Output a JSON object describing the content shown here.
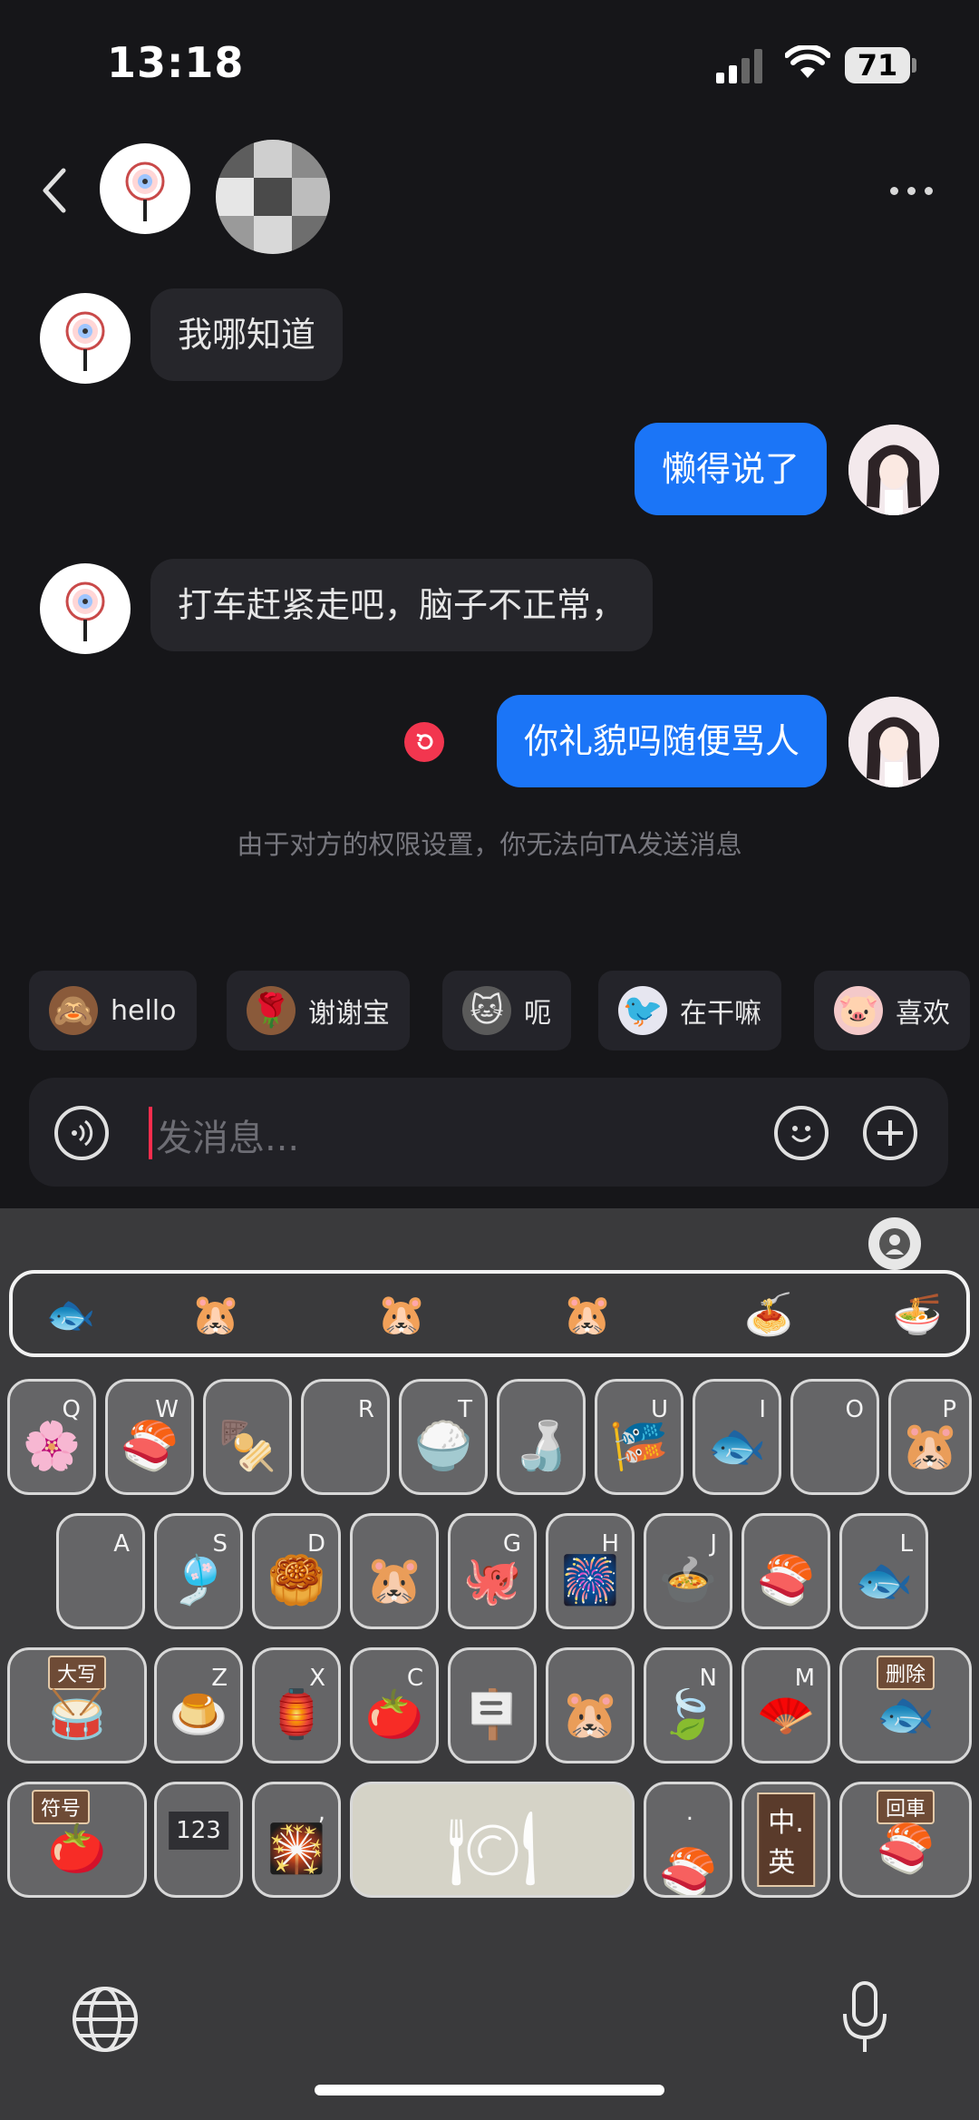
{
  "status_bar": {
    "time": "13:18",
    "battery": "71"
  },
  "header": {
    "back_icon": "chevron-left-icon",
    "more_icon": "ellipsis-icon"
  },
  "messages": [
    {
      "side": "left",
      "text": "我哪知道"
    },
    {
      "side": "right",
      "text": "懒得说了"
    },
    {
      "side": "left",
      "text": "打车赶紧走吧，脑子不正常，"
    },
    {
      "side": "right",
      "text": "你礼貌吗随便骂人",
      "failed": true
    }
  ],
  "system_notice": "由于对方的权限设置，你无法向TA发送消息",
  "quick_replies": [
    "hello",
    "谢谢宝",
    "呃",
    "在干嘛",
    "喜欢"
  ],
  "input": {
    "placeholder": "发消息..."
  },
  "keyboard": {
    "row1": [
      "Q",
      "W",
      "",
      "R",
      "T",
      "",
      "U",
      "I",
      "O",
      "P"
    ],
    "row2": [
      "A",
      "S",
      "D",
      "",
      "G",
      "H",
      "J",
      "",
      "L"
    ],
    "row3": [
      "",
      "Z",
      "X",
      "C",
      "",
      "",
      "N",
      "M",
      ""
    ],
    "tags": {
      "shift": "大写",
      "delete": "删除",
      "symbols": "符号",
      "return": "回車"
    },
    "num_key": "123",
    "comma": ",",
    "period": ".",
    "lang_key": "中.英"
  }
}
